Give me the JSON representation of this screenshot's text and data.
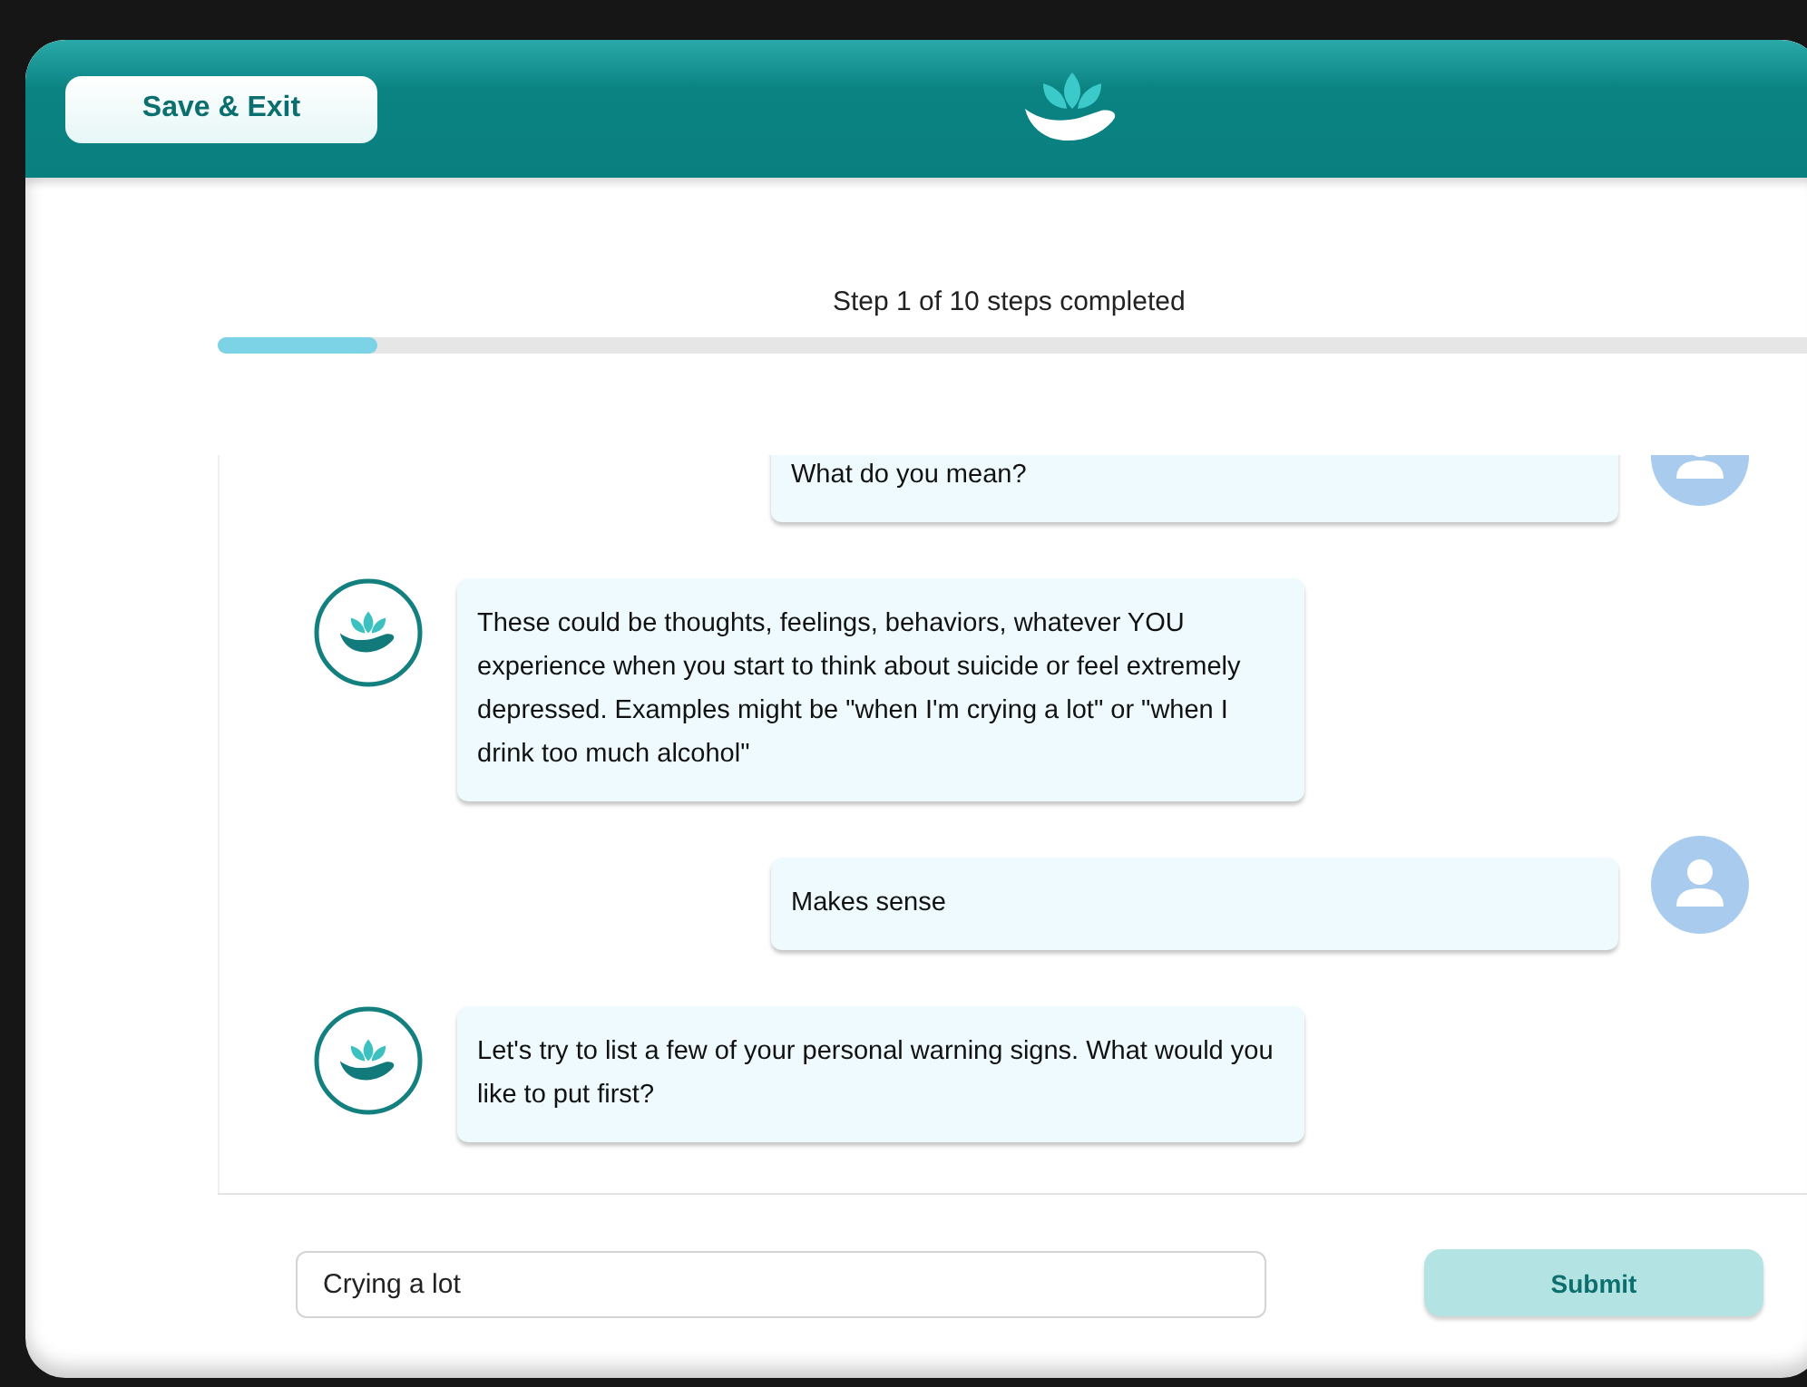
{
  "header": {
    "save_button": "Save & Exit"
  },
  "progress": {
    "label": "Step 1 of 10 steps completed",
    "level": 0.1
  },
  "messages": [
    {
      "kind": "user",
      "text": "What do you mean?"
    },
    {
      "kind": "bot",
      "text": "These could be thoughts, feelings, behaviors, whatever YOU experience when you start to think about suicide or feel extremely depressed. Examples might be \"when I'm crying a lot\" or \"when I drink too much alcohol\""
    },
    {
      "kind": "user",
      "text": "Makes sense"
    },
    {
      "kind": "bot",
      "text": "Let's try to list a few of your personal warning signs. What would you like to put first?"
    }
  ],
  "composer": {
    "value": "Crying a lot",
    "submit": "Submit"
  }
}
